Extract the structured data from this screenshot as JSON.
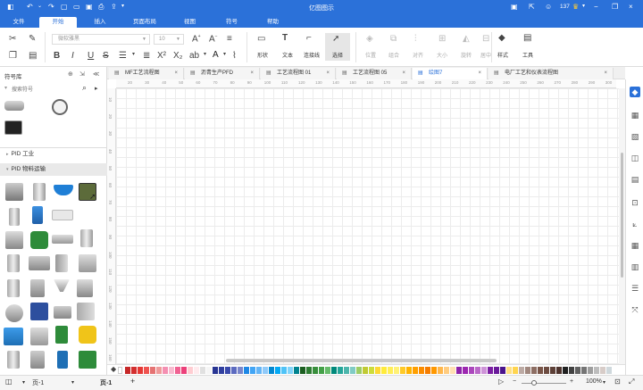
{
  "app": {
    "title": "亿图图示",
    "user_count": "137"
  },
  "menu": [
    {
      "label": "文件"
    },
    {
      "label": "开始"
    },
    {
      "label": "插入"
    },
    {
      "label": "页面布局"
    },
    {
      "label": "视图"
    },
    {
      "label": "符号"
    },
    {
      "label": "帮助"
    }
  ],
  "ribbon": {
    "font_name": "微软雅黑",
    "font_size": "10",
    "tools": [
      {
        "label": "形状"
      },
      {
        "label": "文本"
      },
      {
        "label": "连接线"
      },
      {
        "label": "选择"
      }
    ],
    "arrange": [
      {
        "label": "位置"
      },
      {
        "label": "组合"
      },
      {
        "label": "对齐"
      },
      {
        "label": "大小"
      },
      {
        "label": "旋转"
      },
      {
        "label": "居中"
      }
    ],
    "style_label": "样式",
    "tools_label": "工具"
  },
  "library": {
    "title": "符号库",
    "search_placeholder": "搜索符号",
    "categories": [
      {
        "label": "PID 工业"
      },
      {
        "label": "PID 物料运输"
      }
    ]
  },
  "tabs": [
    {
      "label": "MF工艺流程图",
      "close": "×"
    },
    {
      "label": "沥青生产PFD",
      "close": "×"
    },
    {
      "label": "工艺流程图 01",
      "close": "×"
    },
    {
      "label": "工艺流程图 05",
      "close": "×"
    },
    {
      "label": "绘图7",
      "close": "×"
    },
    {
      "label": "电厂工艺和仪表流程图",
      "close": "×"
    }
  ],
  "ruler": {
    "h": [
      "20",
      "30",
      "40",
      "50",
      "60",
      "70",
      "80",
      "90",
      "100",
      "110",
      "120",
      "130",
      "140",
      "150",
      "160",
      "170",
      "180",
      "190",
      "200",
      "210",
      "220",
      "230",
      "240",
      "250",
      "260",
      "270",
      "280",
      "290",
      "300"
    ],
    "v": [
      "10",
      "20",
      "30",
      "40",
      "50",
      "60",
      "70",
      "80",
      "90",
      "100",
      "110",
      "120",
      "130",
      "140",
      "150",
      "160"
    ]
  },
  "palette_colors": [
    "#c62828",
    "#d32f2f",
    "#e53935",
    "#ef5350",
    "#e57373",
    "#ef9a9a",
    "#f48fb1",
    "#f8bbd0",
    "#f06292",
    "#ec407a",
    "#ffcdd2",
    "#ffebee",
    "#e0e0e0",
    "#f5f5f5",
    "#283593",
    "#303f9f",
    "#3949ab",
    "#5c6bc0",
    "#7986cb",
    "#1e88e5",
    "#42a5f5",
    "#64b5f6",
    "#90caf9",
    "#0288d1",
    "#03a9f4",
    "#4fc3f7",
    "#81d4fa",
    "#00838f",
    "#1b5e20",
    "#2e7d32",
    "#388e3c",
    "#43a047",
    "#66bb6a",
    "#00897b",
    "#26a69a",
    "#4db6ac",
    "#80cbc4",
    "#9ccc65",
    "#c0ca33",
    "#cddc39",
    "#fdd835",
    "#ffeb3b",
    "#ffee58",
    "#fff176",
    "#ffca28",
    "#ffb300",
    "#ffa000",
    "#fb8c00",
    "#f57c00",
    "#ff9800",
    "#ffb74d",
    "#ffcc80",
    "#ffe0b2",
    "#8e24aa",
    "#9c27b0",
    "#ab47bc",
    "#ba68c8",
    "#ce93d8",
    "#7b1fa2",
    "#6a1b9a",
    "#4a148c",
    "#ffe082",
    "#ffd54f",
    "#bcaaa4",
    "#a1887f",
    "#8d6e63",
    "#795548",
    "#6d4c41",
    "#5d4037",
    "#4e342e",
    "#212121",
    "#424242",
    "#616161",
    "#757575",
    "#9e9e9e",
    "#bdbdbd",
    "#d7ccc8",
    "#cfd8dc"
  ],
  "status": {
    "page_selector": "页-1",
    "page_tab": "页-1",
    "add_page": "+",
    "zoom": "100%",
    "zoom_minus": "−",
    "zoom_plus": "+"
  }
}
